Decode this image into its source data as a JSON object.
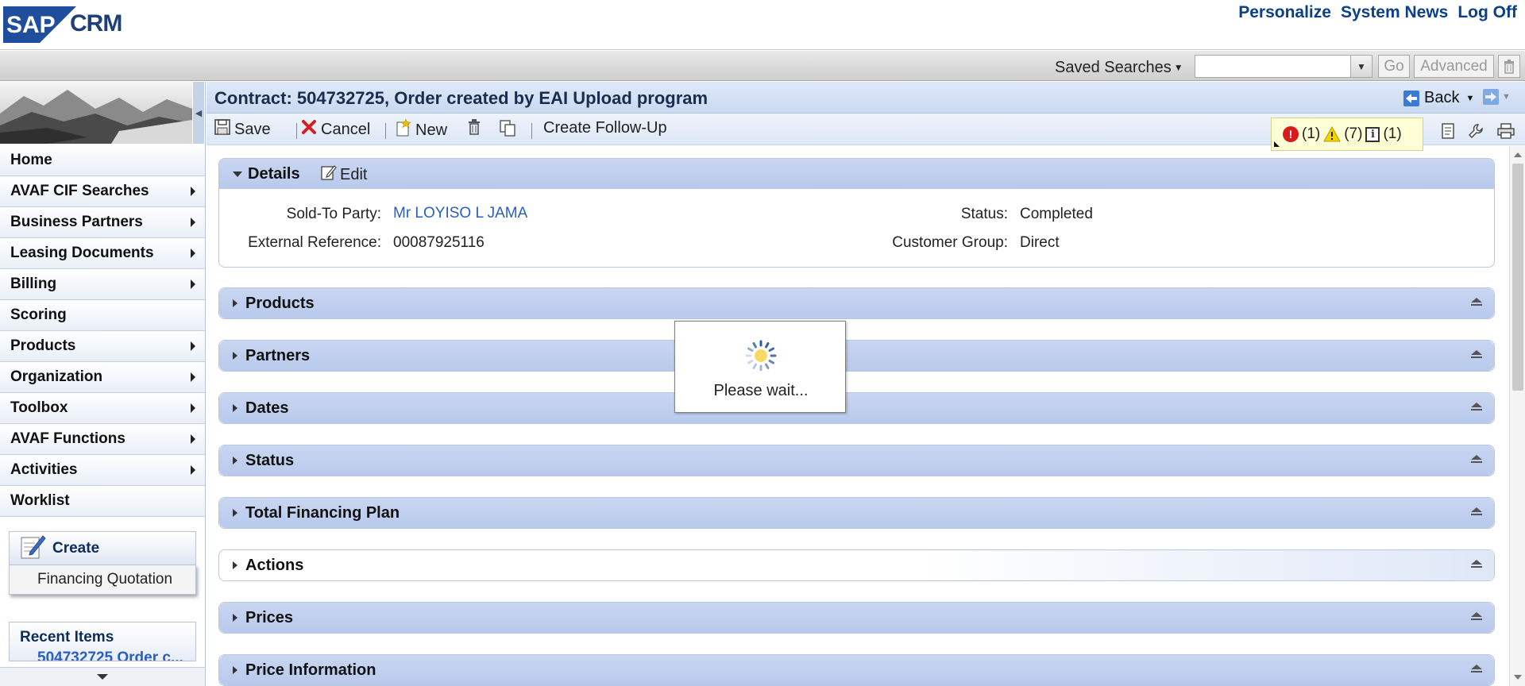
{
  "header": {
    "logo_text": "SAP CRM",
    "links": [
      "Personalize",
      "System News",
      "Log Off"
    ]
  },
  "searchbar": {
    "saved_searches": "Saved Searches",
    "input_value": "",
    "go": "Go",
    "advanced": "Advanced"
  },
  "nav": {
    "items": [
      {
        "label": "Home",
        "submenu": false
      },
      {
        "label": "AVAF CIF Searches",
        "submenu": true
      },
      {
        "label": "Business Partners",
        "submenu": true
      },
      {
        "label": "Leasing Documents",
        "submenu": true
      },
      {
        "label": "Billing",
        "submenu": true
      },
      {
        "label": "Scoring",
        "submenu": false
      },
      {
        "label": "Products",
        "submenu": true
      },
      {
        "label": "Organization",
        "submenu": true
      },
      {
        "label": "Toolbox",
        "submenu": true
      },
      {
        "label": "AVAF Functions",
        "submenu": true
      },
      {
        "label": "Activities",
        "submenu": true
      },
      {
        "label": "Worklist",
        "submenu": false
      }
    ],
    "create_title": "Create",
    "create_item": "Financing Quotation",
    "recent_title": "Recent Items",
    "recent_item": "504732725 Order c..."
  },
  "main": {
    "title": "Contract: 504732725, Order created by EAI Upload program",
    "back": "Back",
    "toolbar": {
      "save": "Save",
      "cancel": "Cancel",
      "new": "New",
      "create_follow_up": "Create Follow-Up"
    },
    "messages": {
      "errors": "(1)",
      "warnings": "(7)",
      "info": "(1)"
    },
    "details": {
      "title": "Details",
      "edit": "Edit",
      "sold_to_label": "Sold-To Party:",
      "sold_to_value": "Mr LOYISO L JAMA",
      "ext_ref_label": "External Reference:",
      "ext_ref_value": "00087925116",
      "status_label": "Status:",
      "status_value": "Completed",
      "cust_group_label": "Customer Group:",
      "cust_group_value": "Direct"
    },
    "sections": [
      "Products",
      "Partners",
      "Dates",
      "Status",
      "Total Financing Plan",
      "Actions",
      "Prices",
      "Price Information"
    ]
  },
  "wait": {
    "text": "Please wait..."
  }
}
